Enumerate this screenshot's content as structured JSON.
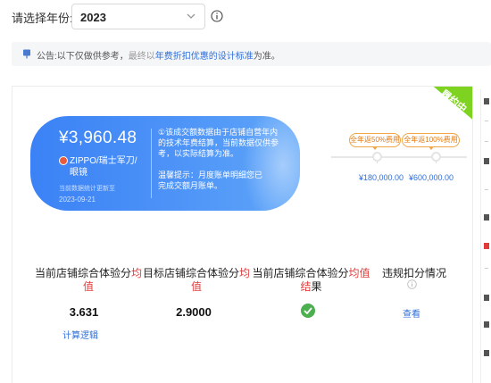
{
  "filter": {
    "label": "请选择年份:",
    "year": "2023"
  },
  "notice": {
    "prefix": "公告:",
    "text_before": "以下仅做供参考，",
    "text_faded": "最终以",
    "link": "年费折扣优惠的设计标准",
    "text_after": "为准。"
  },
  "card": {
    "ribbon": "履约中",
    "pill": {
      "amount": "¥3,960.48",
      "brand": "ZIPPO/瑞士军刀/眼镜",
      "sub_note": "当前数据统计更新至",
      "date": "2023-09-21",
      "desc_1": "①该成交额数据由于店铺自营年内的技术年费结算，当前数据仅供参考，以实际结算为准。",
      "desc_2": "温馨提示：月度账单明细您已完成交额月账单。"
    },
    "tiers": [
      {
        "label": "全年返50%费用",
        "amount": "¥180,000.00"
      },
      {
        "label": "全年返100%费用",
        "amount": "¥600,000.00"
      }
    ],
    "metrics": [
      {
        "title_pre": "当前店铺综合体验分",
        "title_hl": "均值",
        "title_post": "",
        "value": "3.631",
        "link": "计算逻辑"
      },
      {
        "title_pre": "目标店铺综合体验分",
        "title_hl": "均值",
        "title_post": "",
        "value": "2.9000"
      },
      {
        "title_pre": "当前店铺综合体验分",
        "title_hl": "均值结",
        "title_post": "果"
      },
      {
        "title_pre": "违规扣分情况",
        "title_hl": "",
        "title_post": "",
        "link": "查看"
      }
    ]
  },
  "colors": {
    "accent": "#2f6fd8",
    "pill": "#3b82f6",
    "ribbon": "#7ed321",
    "warn": "#e03c3c",
    "success": "#4caf50",
    "tier": "#f0a646"
  }
}
